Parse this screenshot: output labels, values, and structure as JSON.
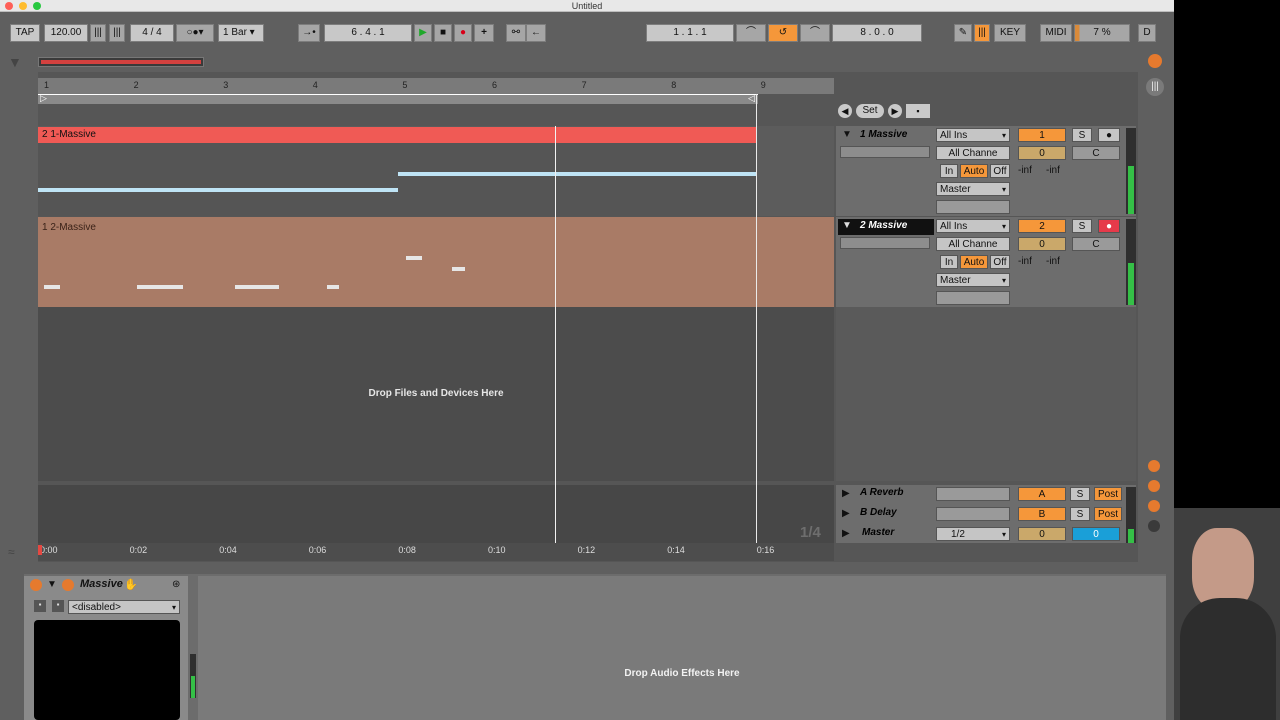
{
  "window": {
    "title": "Untitled"
  },
  "transport": {
    "tap": "TAP",
    "tempo": "120.00",
    "signature": "4 / 4",
    "quantize": "1 Bar",
    "position": "6 . 4 . 1",
    "loop_start": "1 . 1 . 1",
    "loop_length": "8 . 0 . 0",
    "key": "KEY",
    "midi": "MIDI",
    "cpu": "7 %",
    "d": "D"
  },
  "ruler": {
    "bars": [
      "1",
      "2",
      "3",
      "4",
      "5",
      "6",
      "7",
      "8",
      "9"
    ]
  },
  "timeline": {
    "labels": [
      "0:00",
      "0:02",
      "0:04",
      "0:06",
      "0:08",
      "0:10",
      "0:12",
      "0:14",
      "0:16"
    ]
  },
  "tracks": [
    {
      "clip_label": "2 1-Massive",
      "name": "1 Massive",
      "input": "All Ins",
      "channel": "All Channe",
      "num": "1",
      "solo": "S",
      "vol": "0",
      "pan": "C",
      "in": "In",
      "auto": "Auto",
      "off": "Off",
      "inf1": "-inf",
      "inf2": "-inf",
      "out": "Master"
    },
    {
      "clip_label": "1 2-Massive",
      "name": "2 Massive",
      "input": "All Ins",
      "channel": "All Channe",
      "num": "2",
      "solo": "S",
      "vol": "0",
      "pan": "C",
      "in": "In",
      "auto": "Auto",
      "off": "Off",
      "inf1": "-inf",
      "inf2": "-inf",
      "out": "Master"
    }
  ],
  "returns": [
    {
      "name": "A Reverb",
      "letter": "A",
      "solo": "S",
      "post": "Post"
    },
    {
      "name": "B Delay",
      "letter": "B",
      "solo": "S",
      "post": "Post"
    }
  ],
  "master": {
    "name": "Master",
    "out": "1/2",
    "vol": "0",
    "pan": "0"
  },
  "arrangement": {
    "drop_hint": "Drop Files and Devices Here",
    "zoom": "1/4"
  },
  "set_button": "Set",
  "device": {
    "name": "Massive",
    "preset": "<disabled>",
    "drop_hint": "Drop Audio Effects Here"
  },
  "colors": {
    "track1": "#f05a55",
    "track2": "#b9866e",
    "accent": "#f5973a"
  }
}
